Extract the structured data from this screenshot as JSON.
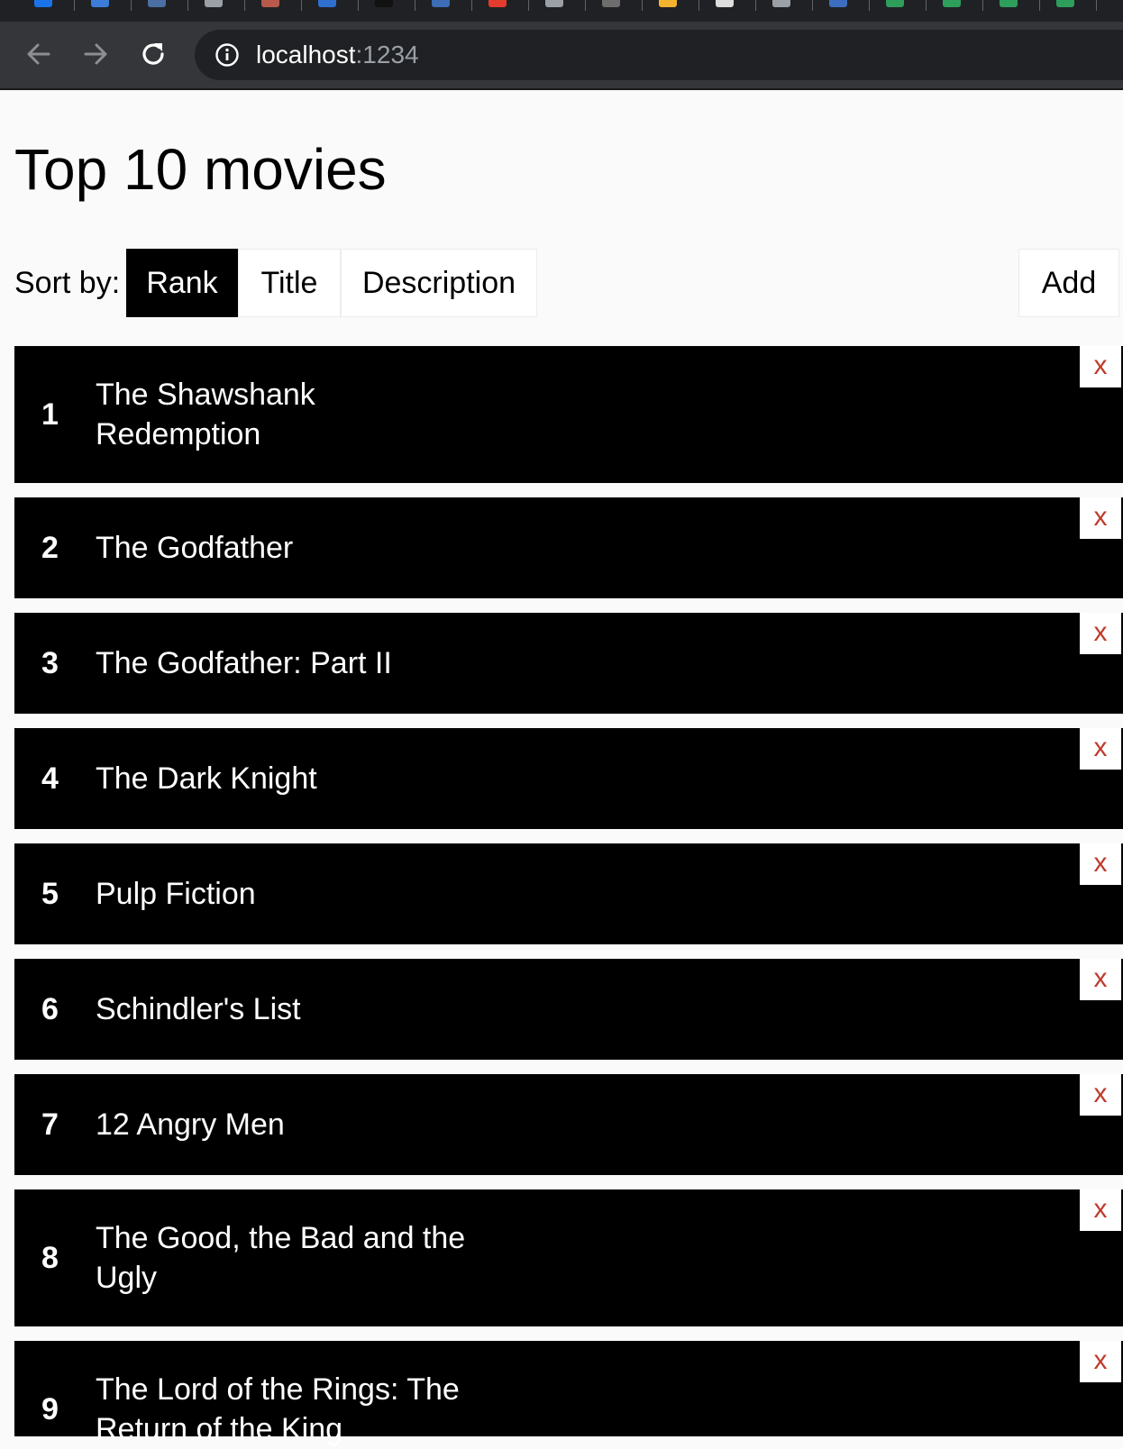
{
  "browser": {
    "url_host": "localhost",
    "url_port": ":1234",
    "tab_favicon_colors": [
      "#1a73e8",
      "#3b7dd8",
      "#4a6fa5",
      "#9aa0a6",
      "#b85a4b",
      "#2f6fcf",
      "#111111",
      "#3d6db5",
      "#e33b2e",
      "#9aa0a6",
      "#6d6d6d",
      "#f3b42f",
      "#dddddd",
      "#9aa0a6",
      "#3c6ec0",
      "#2e9e5b",
      "#2e9e5b",
      "#2e9e5b",
      "#2e9e5b"
    ]
  },
  "page": {
    "title": "Top 10 movies"
  },
  "sort": {
    "label": "Sort by:",
    "options": [
      "Rank",
      "Title",
      "Description"
    ],
    "active": "Rank"
  },
  "actions": {
    "add_label": "Add",
    "remove_label": "x"
  },
  "movies": [
    {
      "rank": "1",
      "title": "The Shawshank Redemption"
    },
    {
      "rank": "2",
      "title": "The Godfather"
    },
    {
      "rank": "3",
      "title": "The Godfather: Part II"
    },
    {
      "rank": "4",
      "title": "The Dark Knight"
    },
    {
      "rank": "5",
      "title": "Pulp Fiction"
    },
    {
      "rank": "6",
      "title": "Schindler's List"
    },
    {
      "rank": "7",
      "title": "12 Angry Men"
    },
    {
      "rank": "8",
      "title": "The Good, the Bad and the Ugly"
    },
    {
      "rank": "9",
      "title": "The Lord of the Rings: The Return of the King"
    }
  ],
  "colors": {
    "remove_x": "#c0392b",
    "row_bg": "#000000",
    "page_bg": "#fafafa"
  }
}
